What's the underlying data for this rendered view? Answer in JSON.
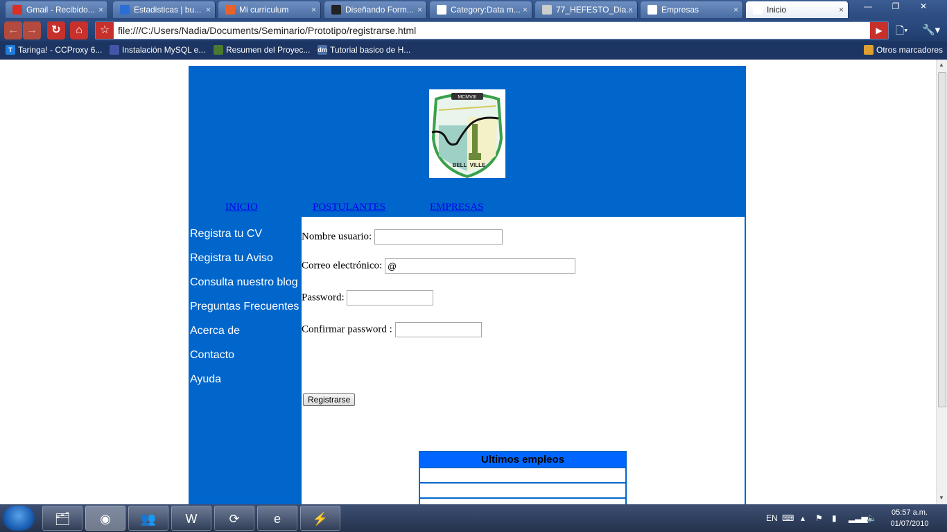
{
  "browser": {
    "tabs": [
      {
        "title": "Gmail - Recibido...",
        "color": "#d93025"
      },
      {
        "title": "Estadisticas | bu...",
        "color": "#2a6fd6"
      },
      {
        "title": "Mi curriculum",
        "color": "#e8622b"
      },
      {
        "title": "Diseñando Form...",
        "color": "#222222"
      },
      {
        "title": "Category:Data m...",
        "color": "#ffffff"
      },
      {
        "title": "77_HEFESTO_Dia...",
        "color": "#cccccc"
      },
      {
        "title": "Empresas",
        "color": "#ffffff"
      },
      {
        "title": "Inicio",
        "color": "#ffffff"
      }
    ],
    "tab_close": "×",
    "url": "file:///C:/Users/Nadia/Documents/Seminario/Prototipo/registrarse.html",
    "bookmarks": [
      {
        "label": "Taringa! - CCProxy 6...",
        "icon": "T",
        "color": "#1f7de0"
      },
      {
        "label": "Instalación MySQL e...",
        "icon": "",
        "color": "#4455aa"
      },
      {
        "label": "Resumen del Proyec...",
        "icon": "",
        "color": "#4a7a30"
      },
      {
        "label": "Tutorial basico de H...",
        "icon": "dm",
        "color": "#4b6fa8"
      }
    ],
    "other_bookmarks": "Otros marcadores"
  },
  "site": {
    "nav": {
      "inicio": "INICIO",
      "postulantes": "POSTULANTES",
      "empresas": "EMPRESAS"
    },
    "sidebar": [
      "Registra tu CV",
      "Registra tu Aviso",
      "Consulta nuestro blog",
      "Preguntas Frecuentes",
      "Acerca de",
      "Contacto",
      "Ayuda"
    ],
    "form": {
      "username_label": "Nombre usuario:",
      "username_value": "",
      "email_label": "Correo electrónico:",
      "email_value": "@",
      "password_label": "Password:",
      "password_value": "",
      "confirm_label": "Confirmar password :",
      "confirm_value": "",
      "submit_label": "Registrarse"
    },
    "jobs_table": {
      "title": "Ultimos empleos"
    },
    "logo": {
      "top_text": "MCMVIII",
      "bottom_left": "BELL",
      "bottom_right": "VILLE"
    }
  },
  "taskbar": {
    "language": "EN",
    "time": "05:57 a.m.",
    "date": "01/07/2010"
  },
  "colors": {
    "page_blue": "#0066cc",
    "table_header": "#0066ff",
    "link": "#0000ee"
  }
}
